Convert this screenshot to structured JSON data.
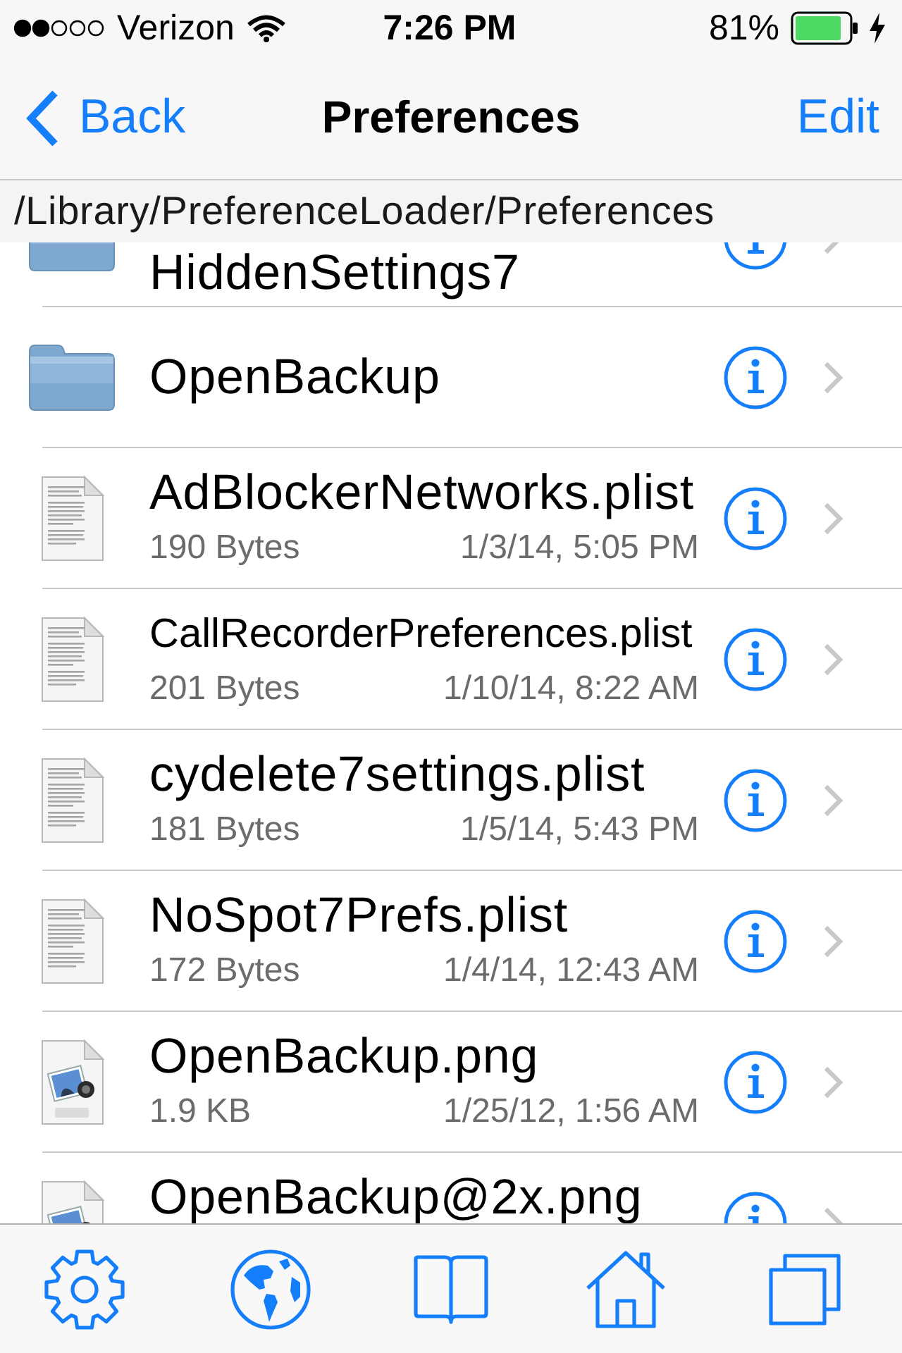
{
  "status_bar": {
    "carrier": "Verizon",
    "time": "7:26 PM",
    "battery_percent": "81%"
  },
  "nav_bar": {
    "back_label": "Back",
    "title": "Preferences",
    "action_label": "Edit"
  },
  "path": "/Library/PreferenceLoader/Preferences",
  "files": [
    {
      "kind": "folder",
      "name": "HiddenSettings7"
    },
    {
      "kind": "folder",
      "name": "OpenBackup"
    },
    {
      "kind": "document",
      "name": "AdBlockerNetworks.plist",
      "size": "190 Bytes",
      "modified": "1/3/14, 5:05 PM"
    },
    {
      "kind": "document",
      "name": "CallRecorderPreferences.plist",
      "size": "201 Bytes",
      "modified": "1/10/14, 8:22 AM"
    },
    {
      "kind": "document",
      "name": "cydelete7settings.plist",
      "size": "181 Bytes",
      "modified": "1/5/14, 5:43 PM"
    },
    {
      "kind": "document",
      "name": "NoSpot7Prefs.plist",
      "size": "172 Bytes",
      "modified": "1/4/14, 12:43 AM"
    },
    {
      "kind": "image",
      "name": "OpenBackup.png",
      "size": "1.9 KB",
      "modified": "1/25/12, 1:56 AM"
    },
    {
      "kind": "image",
      "name": "OpenBackup@2x.png"
    }
  ]
}
